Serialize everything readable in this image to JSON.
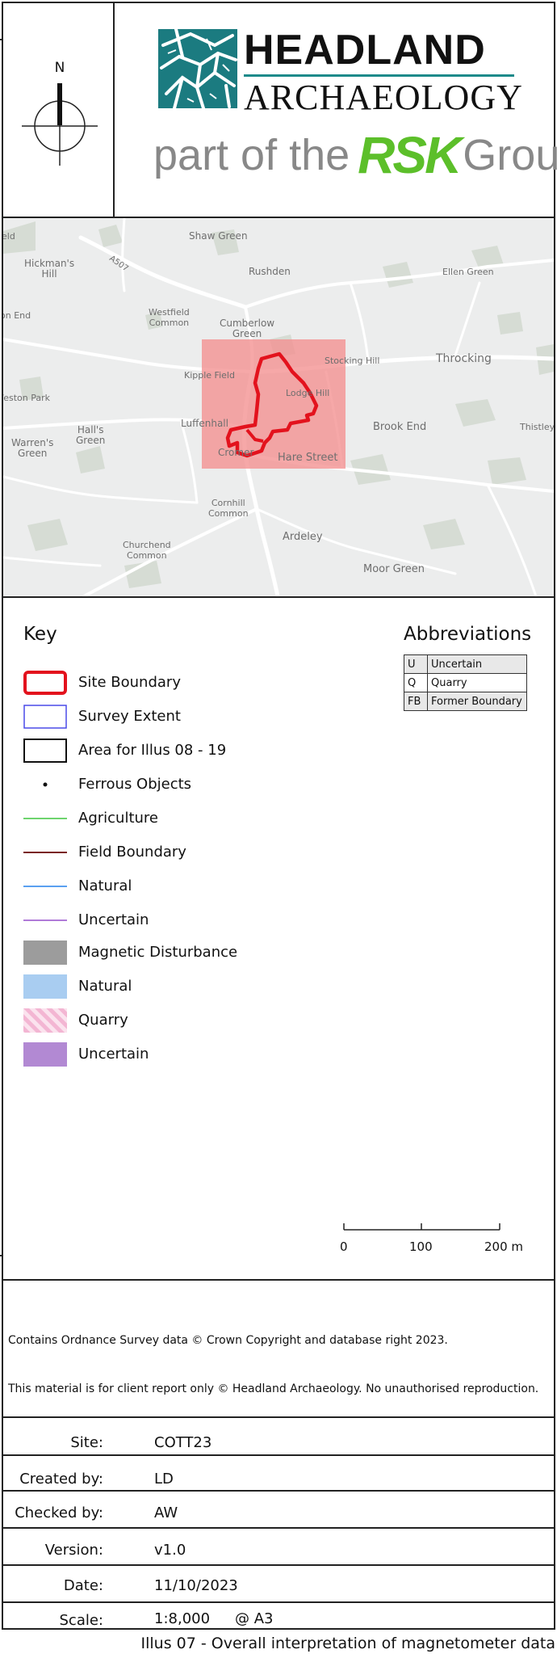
{
  "header": {
    "north_label": "N",
    "brand_line1": "HEADLAND",
    "brand_line2": "ARCHAEOLOGY",
    "tagline_prefix": "part of the",
    "tagline_rsk": "RSK",
    "tagline_suffix": "Group",
    "brand_color": "#1b7b80",
    "rsk_color": "#5cbf2a"
  },
  "map": {
    "places": [
      {
        "name": "Shaw Green"
      },
      {
        "name": "Hickman's\nHill"
      },
      {
        "name": "Rushden"
      },
      {
        "name": "Ellen Green"
      },
      {
        "name": "Westfield\nCommon"
      },
      {
        "name": "Cumberlow\nGreen"
      },
      {
        "name": "Kipple Field"
      },
      {
        "name": "Stocking Hill"
      },
      {
        "name": "Throcking"
      },
      {
        "name": "Lodge Hill"
      },
      {
        "name": "Luffenhall"
      },
      {
        "name": "Brook End"
      },
      {
        "name": "Thistley"
      },
      {
        "name": "Hall's\nGreen"
      },
      {
        "name": "Warren's\nGreen"
      },
      {
        "name": "Weston Park"
      },
      {
        "name": "Cromer"
      },
      {
        "name": "Hare Street"
      },
      {
        "name": "Cornhill\nCommon"
      },
      {
        "name": "Ardeley"
      },
      {
        "name": "Churchend\nCommon"
      },
      {
        "name": "Moor Green"
      },
      {
        "name": "on End"
      },
      {
        "name": "A507"
      },
      {
        "name": "eld"
      }
    ],
    "highlight_color": "#f4908f",
    "boundary_color": "#e3121d"
  },
  "key": {
    "title": "Key",
    "items": [
      {
        "label": "Site Boundary",
        "icon": "site-boundary-swatch",
        "color": "#e3121d"
      },
      {
        "label": "Survey Extent",
        "icon": "survey-extent-swatch",
        "color": "#4a4ae8"
      },
      {
        "label": "Area for Illus 08 - 19",
        "icon": "area-illus-swatch",
        "color": "#111111"
      },
      {
        "label": "Ferrous Objects",
        "icon": "ferrous-dot",
        "color": "#111111"
      },
      {
        "label": "Agriculture",
        "icon": "agriculture-line",
        "color": "#6ed46e"
      },
      {
        "label": "Field Boundary",
        "icon": "field-boundary-line",
        "color": "#7a1f1f"
      },
      {
        "label": "Natural",
        "icon": "natural-line",
        "color": "#5aa0f0"
      },
      {
        "label": "Uncertain",
        "icon": "uncertain-line",
        "color": "#b07ad8"
      },
      {
        "label": "Magnetic Disturbance",
        "icon": "magnetic-disturbance-fill",
        "color": "#9c9c9c"
      },
      {
        "label": "Natural",
        "icon": "natural-fill",
        "color": "#a9cdf1"
      },
      {
        "label": "Quarry",
        "icon": "quarry-hatch-fill",
        "color": "#f7c6dc"
      },
      {
        "label": "Uncertain",
        "icon": "uncertain-fill",
        "color": "#b289d3"
      }
    ]
  },
  "abbreviations": {
    "title": "Abbreviations",
    "rows": [
      {
        "code": "U",
        "meaning": "Uncertain"
      },
      {
        "code": "Q",
        "meaning": "Quarry"
      },
      {
        "code": "FB",
        "meaning": "Former Boundary"
      }
    ]
  },
  "scale_bar": {
    "labels": [
      "0",
      "100",
      "200 m"
    ]
  },
  "notices": {
    "copyright_os": "Contains Ordnance Survey data © Crown Copyright and database right 2023.",
    "copyright_headland": "This material is for client report only © Headland Archaeology. No unauthorised reproduction."
  },
  "details": [
    {
      "label": "Site:",
      "value": "COTT23"
    },
    {
      "label": "Created by:",
      "value": "LD"
    },
    {
      "label": "Checked by:",
      "value": "AW"
    },
    {
      "label": "Version:",
      "value": "v1.0"
    },
    {
      "label": "Date:",
      "value": "11/10/2023"
    },
    {
      "label": "Scale:",
      "value": "1:8,000",
      "extra": "@ A3"
    }
  ],
  "caption": "Illus 07 - Overall interpretation of magnetometer data"
}
